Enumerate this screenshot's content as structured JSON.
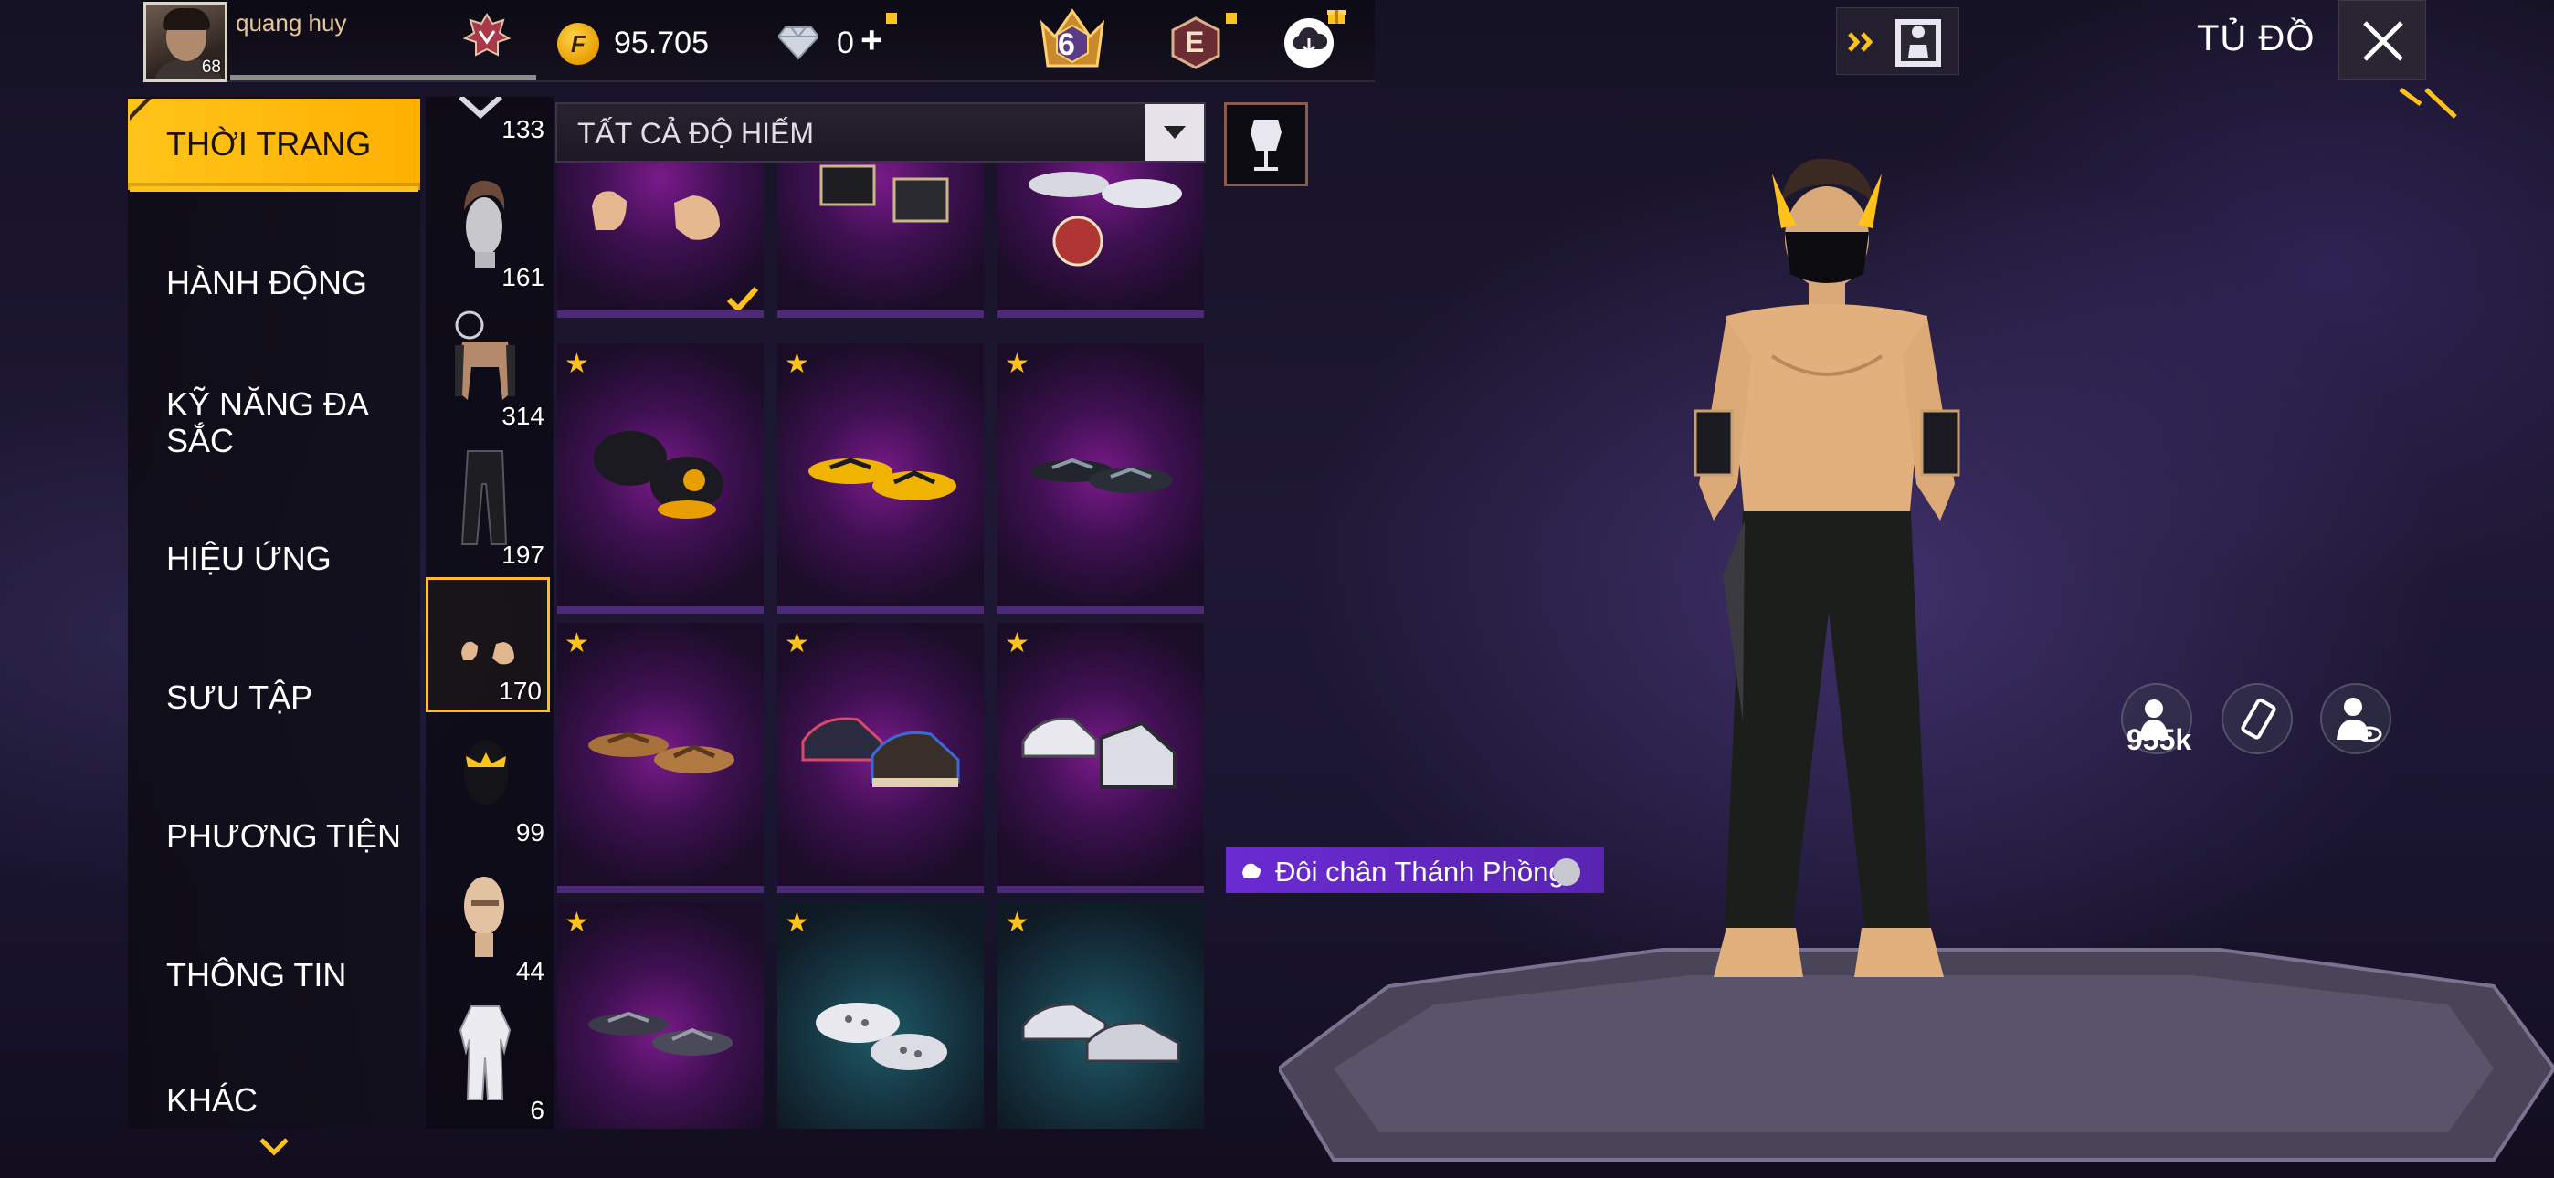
{
  "header": {
    "player_name": "quang huy",
    "player_level": "68",
    "gold": "95.705",
    "diamonds": "0",
    "diamonds_plus": "+",
    "level_badge": "6",
    "elite_badge": "E",
    "page_title": "TỦ ĐỒ"
  },
  "menu": {
    "items": [
      {
        "label": "THỜI TRANG"
      },
      {
        "label": "HÀNH ĐỘNG"
      },
      {
        "label": "KỸ NĂNG ĐA SẮC"
      },
      {
        "label": "HIỆU ỨNG"
      },
      {
        "label": "SƯU TẬP"
      },
      {
        "label": "PHƯƠNG TIỆN"
      },
      {
        "label": "THÔNG TIN"
      },
      {
        "label": "KHÁC"
      }
    ]
  },
  "subcategories": [
    {
      "name": "mask",
      "count": "133"
    },
    {
      "name": "hair",
      "count": "161"
    },
    {
      "name": "top",
      "count": "314"
    },
    {
      "name": "bottom",
      "count": "197"
    },
    {
      "name": "shoes",
      "count": "170"
    },
    {
      "name": "mask-head",
      "count": "99"
    },
    {
      "name": "face",
      "count": "44"
    },
    {
      "name": "outfit",
      "count": "6"
    }
  ],
  "filter": {
    "label": "TẤT CẢ ĐỘ HIẾM"
  },
  "grid": {
    "items": [
      {
        "name": "bare-feet",
        "starred": false,
        "equipped": true
      },
      {
        "name": "black-boots",
        "starred": false,
        "equipped": false
      },
      {
        "name": "demon-slayer-sandals",
        "starred": false,
        "equipped": false
      },
      {
        "name": "cat-slippers",
        "starred": true,
        "equipped": false
      },
      {
        "name": "yellow-flip-flops",
        "starred": true,
        "equipped": false
      },
      {
        "name": "dark-flip-flops",
        "starred": true,
        "equipped": false
      },
      {
        "name": "brown-flip-flops",
        "starred": true,
        "equipped": false
      },
      {
        "name": "colorful-sneakers",
        "starred": true,
        "equipped": false
      },
      {
        "name": "white-sneakers",
        "starred": true,
        "equipped": false
      },
      {
        "name": "grey-flip-flops",
        "starred": true,
        "equipped": false
      },
      {
        "name": "white-sandals",
        "starred": true,
        "equipped": false
      },
      {
        "name": "silver-sneakers",
        "starred": true,
        "equipped": false
      }
    ]
  },
  "preview": {
    "item_name": "Đôi chân Thánh Phồng",
    "likes": "955k"
  },
  "colors": {
    "accent": "#ffc41a",
    "rarity_purple": "#7a1a8a",
    "rarity_teal": "#1f5a67",
    "tag_purple": "#6a2bd2"
  },
  "icons": {
    "gold": "gold-coin-icon",
    "diamond": "diamond-icon",
    "close": "close-icon",
    "dropdown": "chevron-down-icon",
    "more": "chevron-down-icon"
  }
}
